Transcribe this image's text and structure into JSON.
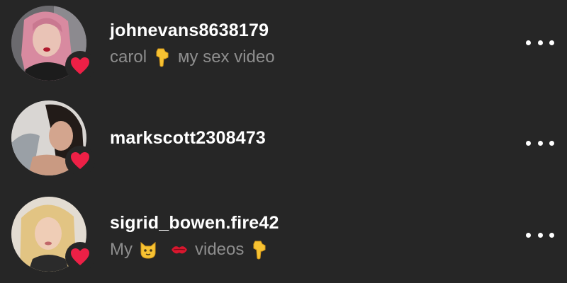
{
  "theme": {
    "background": "#262626",
    "username_color": "#ffffff",
    "subtitle_color": "#8e8e8e",
    "heart_color": "#ed2046"
  },
  "accounts": [
    {
      "username": "johnevans8638179",
      "subtitle_parts": [
        "carol",
        "backhand-index-pointing-down-emoji",
        "мy sex video"
      ],
      "badge_icon": "heart-icon",
      "more_icon": "more-options-icon"
    },
    {
      "username": "markscott2308473",
      "subtitle_parts": [],
      "badge_icon": "heart-icon",
      "more_icon": "more-options-icon"
    },
    {
      "username": "sigrid_bowen.fire42",
      "subtitle_parts": [
        "My",
        "cat-face-emoji",
        "kiss-mark-emoji",
        "videos",
        "backhand-index-pointing-down-emoji"
      ],
      "badge_icon": "heart-icon",
      "more_icon": "more-options-icon"
    }
  ],
  "text": {
    "row0_sub_a": "carol",
    "row0_sub_b": "мy sex video",
    "row2_sub_a": "My",
    "row2_sub_b": "videos"
  }
}
